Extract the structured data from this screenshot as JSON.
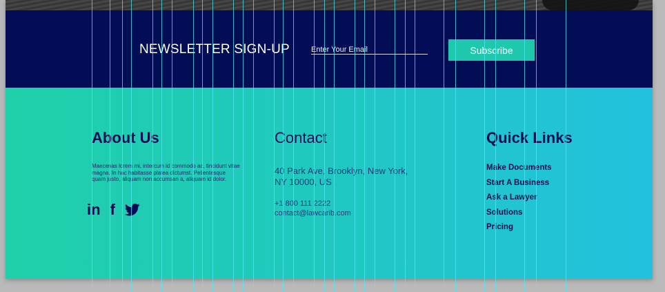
{
  "newsletter": {
    "title": "NEWSLETTER SIGN-UP",
    "email_placeholder": "Enter Your Email",
    "subscribe_label": "Subscribe"
  },
  "about": {
    "title": "About Us",
    "text": "Maecenas lorem mi, intercum id commodo ac, tincidunt vitae magna. In hac habitasse platea dictumst. Pellentesque quam justo, aliquam non accumsan a, aliquam id dolor.",
    "social": [
      {
        "icon": "linkedin-icon",
        "glyph": "in"
      },
      {
        "icon": "facebook-icon",
        "glyph": "f"
      },
      {
        "icon": "twitter-icon",
        "glyph": "🐦"
      }
    ]
  },
  "contact": {
    "title": "Contact",
    "address": "40 Park Ave, Brooklyn, New York,\nNY 10000, US",
    "phone": "+1 800 111 2222",
    "email": "contact@lawcarib.com"
  },
  "quick_links": {
    "title": "Quick Links",
    "items": [
      "Make Documents",
      "Start A Business",
      "Ask a Lawyer",
      "Solutions",
      "Pricing"
    ]
  },
  "colors": {
    "navy": "#020d55",
    "teal_button": "#1ec8ad",
    "gradient_left": "#1fcfa9",
    "gradient_right": "#22c1dd",
    "guide_lines": "#4fe8f5"
  }
}
